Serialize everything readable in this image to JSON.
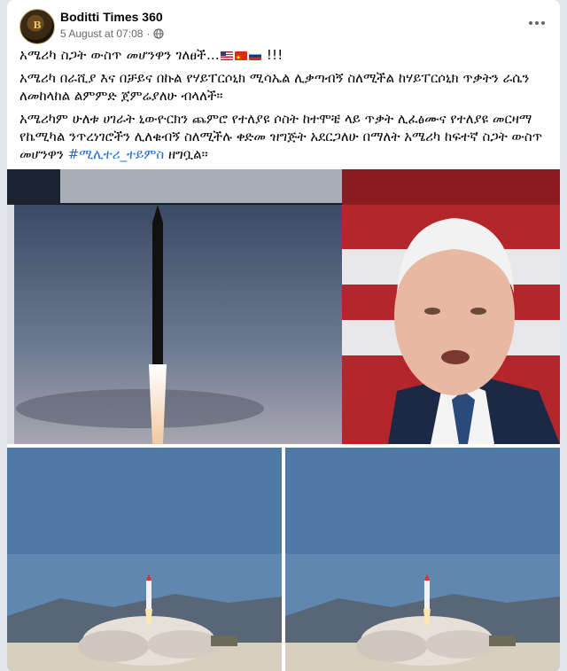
{
  "post": {
    "page_name": "Boditti Times 360",
    "avatar_text": "B",
    "timestamp": "5 August at 07:08",
    "separator": "·",
    "text_line1": "አሜሪካ ስጋት ውስጥ መሆንዋን ገለፀች...",
    "text_line1_tail": "!!!",
    "text_para2": "አሜሪካ በራሺያ እና በቻይና በኩል የሃይፐርሶኒክ ሚሳኤል ሊቃጣብኝ ስለሚችል ከሃይፐርሶኒክ ጥቃትን ራሴን ለመከላከል ልምምድ ጀምሬያለሁ ብላለች።",
    "text_para3": "አሜሪካም ሁለቱ ሀገራት ኒውዮርክን ጨምሮ የተለያዩ ሶስት ከተሞቼ ላይ ጥቃት ሊፈፅሙና የተለያዩ መርዛማ የኬሚካል ንጥረነገሮችን ሊለቁብኝ ስለሚችሉ ቀድመ ዝግጅት አደርጋለሁ በማለት አሜሪካ ከፍተኛ ስጋት ውስጥ መሆንዋን",
    "hashtag": "#ሚሊተሪ_ተይምስ",
    "text_para3_tail": "ዘግቧል።",
    "flags": [
      "us-flag-icon",
      "china-flag-icon",
      "russia-flag-icon"
    ]
  },
  "images": [
    {
      "name": "hypersonic-missile-and-biden-photo"
    },
    {
      "name": "missile-launch-photo-left"
    },
    {
      "name": "missile-launch-photo-right"
    }
  ],
  "colors": {
    "background": "#e4e6eb",
    "hashtag": "#216fdb",
    "meta_text": "#65676b"
  }
}
